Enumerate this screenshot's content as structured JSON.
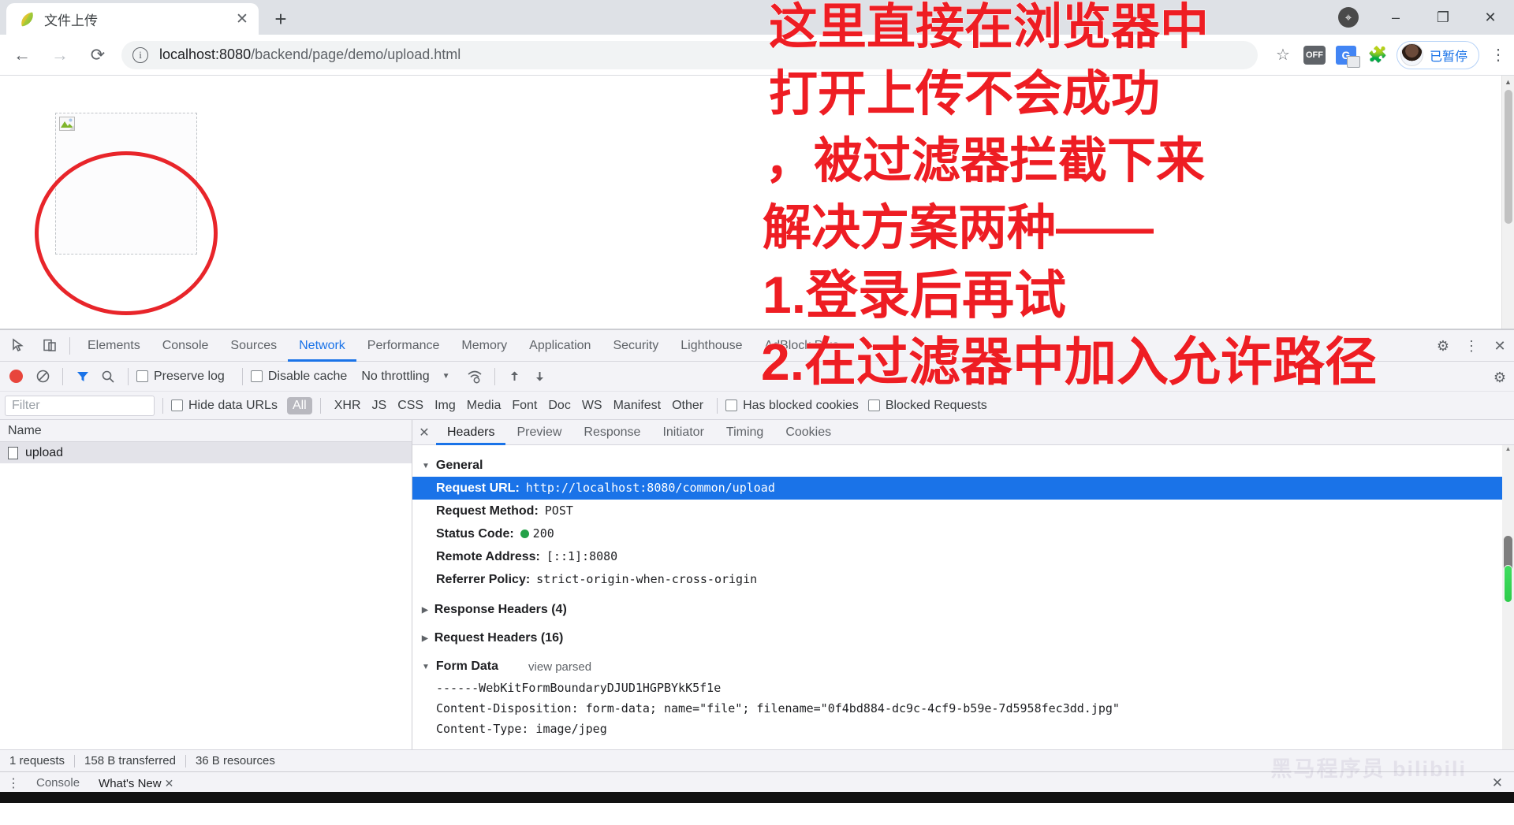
{
  "browser": {
    "tab": {
      "title": "文件上传",
      "favicon_icon": "leaf-favicon",
      "close_icon": "close-icon"
    },
    "newtab_icon": "plus-icon",
    "window_controls": {
      "minimize": "–",
      "maximize": "❐",
      "close": "✕",
      "pin_icon": "location-pin-icon"
    },
    "nav": {
      "back_icon": "←",
      "forward_icon": "→",
      "reload_icon": "⟳"
    },
    "omnibox": {
      "info_icon": "info-circle-icon",
      "url_host": "localhost:8080",
      "url_path": "/backend/page/demo/upload.html",
      "url_full": "localhost:8080/backend/page/demo/upload.html"
    },
    "toolbar_icons": {
      "bookmark": "star-icon",
      "off_badge": "OFF",
      "translate": "G",
      "extensions": "puzzle-icon",
      "menu": "three-dot-menu-icon"
    },
    "profile": {
      "label": "已暂停",
      "avatar_icon": "avatar"
    }
  },
  "page_content": {
    "upload_box_alt": "broken-image",
    "annotation_shape": "red-circle"
  },
  "devtools": {
    "left_tools": {
      "inspect_icon": "inspect-element-icon",
      "device_icon": "device-toolbar-icon"
    },
    "tabs": [
      {
        "label": "Elements",
        "active": false
      },
      {
        "label": "Console",
        "active": false
      },
      {
        "label": "Sources",
        "active": false
      },
      {
        "label": "Network",
        "active": true
      },
      {
        "label": "Performance",
        "active": false
      },
      {
        "label": "Memory",
        "active": false
      },
      {
        "label": "Application",
        "active": false
      },
      {
        "label": "Security",
        "active": false
      },
      {
        "label": "Lighthouse",
        "active": false
      },
      {
        "label": "AdBlock Plus",
        "active": false
      }
    ],
    "tabbar_right": {
      "settings": "gear-icon",
      "more": "three-dot-menu-icon",
      "close": "close-icon"
    },
    "network_toolbar": {
      "record_icon": "record-stop-icon",
      "clear_icon": "clear-icon",
      "filter_icon": "funnel-icon",
      "search_icon": "search-icon",
      "preserve_log": "Preserve log",
      "disable_cache": "Disable cache",
      "throttling": "No throttling",
      "throttle_caret": "▾",
      "wifi_icon": "network-conditions-icon",
      "import_icon": "import-har-icon",
      "export_icon": "export-har-icon",
      "settings_icon": "gear-icon"
    },
    "filter_bar": {
      "filter_placeholder": "Filter",
      "hide_data_urls": "Hide data URLs",
      "types": [
        "All",
        "XHR",
        "JS",
        "CSS",
        "Img",
        "Media",
        "Font",
        "Doc",
        "WS",
        "Manifest",
        "Other"
      ],
      "selected_type": "All",
      "has_blocked_cookies": "Has blocked cookies",
      "blocked_requests": "Blocked Requests"
    },
    "request_list": {
      "column_header": "Name",
      "rows": [
        {
          "name": "upload",
          "icon": "document-icon",
          "selected": true
        }
      ]
    },
    "detail": {
      "close_icon": "close-icon",
      "tabs": [
        {
          "label": "Headers",
          "active": true
        },
        {
          "label": "Preview",
          "active": false
        },
        {
          "label": "Response",
          "active": false
        },
        {
          "label": "Initiator",
          "active": false
        },
        {
          "label": "Timing",
          "active": false
        },
        {
          "label": "Cookies",
          "active": false
        }
      ],
      "general": {
        "title": "General",
        "expanded": true,
        "rows": [
          {
            "key": "Request URL:",
            "value": "http://localhost:8080/common/upload",
            "highlighted": true
          },
          {
            "key": "Request Method:",
            "value": "POST",
            "highlighted": false
          },
          {
            "key": "Status Code:",
            "value": "200",
            "status_dot": "#24a148",
            "highlighted": false
          },
          {
            "key": "Remote Address:",
            "value": "[::1]:8080",
            "highlighted": false
          },
          {
            "key": "Referrer Policy:",
            "value": "strict-origin-when-cross-origin",
            "highlighted": false
          }
        ]
      },
      "response_headers": {
        "title": "Response Headers (4)",
        "expanded": false
      },
      "request_headers": {
        "title": "Request Headers (16)",
        "expanded": false
      },
      "form_data": {
        "title": "Form Data",
        "view_parsed": "view parsed",
        "expanded": true,
        "lines": [
          "------WebKitFormBoundaryDJUD1HGPBYkK5f1e",
          "Content-Disposition: form-data; name=\"file\"; filename=\"0f4bd884-dc9c-4cf9-b59e-7d5958fec3dd.jpg\"",
          "Content-Type: image/jpeg"
        ]
      }
    },
    "status_bar": {
      "requests": "1 requests",
      "transferred": "158 B transferred",
      "resources": "36 B resources"
    },
    "drawer": {
      "menu_icon": "three-dot-menu-icon",
      "tabs": [
        {
          "label": "Console",
          "active": false
        },
        {
          "label": "What's New",
          "active": true,
          "closable": true
        }
      ],
      "close_icon": "close-icon"
    }
  },
  "overlay_annotation": {
    "color": "#ee1d23",
    "lines": [
      "这里直接在浏览器中",
      "打开上传不会成功",
      "，被过滤器拦截下来",
      "解决方案两种——",
      "1.登录后再试",
      "2.在过滤器中加入允许路径"
    ]
  },
  "watermark": {
    "text": "黑马程序员 bilibili"
  }
}
